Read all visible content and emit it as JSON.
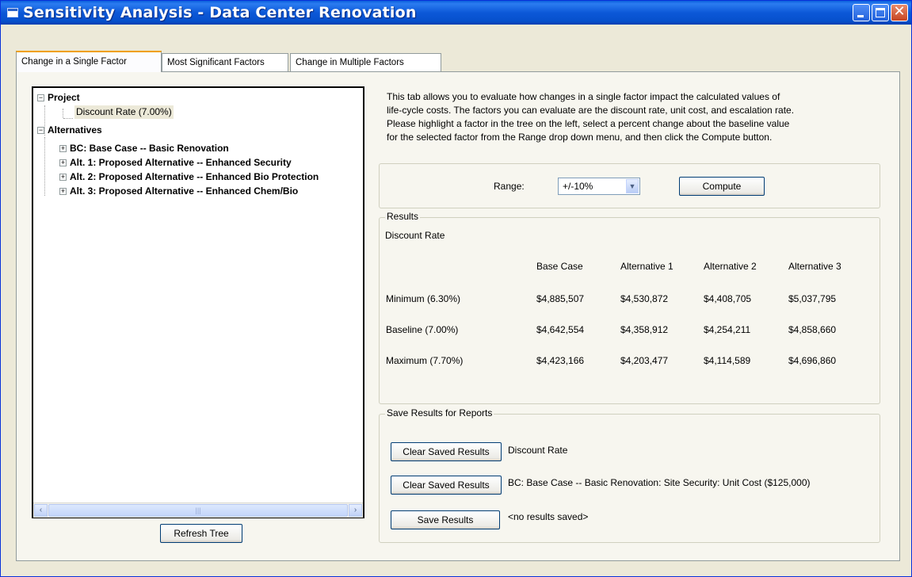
{
  "window": {
    "title": "Sensitivity Analysis - Data Center Renovation",
    "close_glyph": "✕"
  },
  "tabs": [
    {
      "label": "Change in a Single Factor",
      "active": true
    },
    {
      "label": "Most Significant Factors",
      "active": false
    },
    {
      "label": "Change in Multiple Factors",
      "active": false
    }
  ],
  "tree": {
    "collapse_glyph": "−",
    "expand_glyph": "+",
    "project": {
      "label": "Project",
      "children": [
        "Discount Rate (7.00%)"
      ]
    },
    "alternatives": {
      "label": "Alternatives",
      "children": [
        "BC: Base Case -- Basic Renovation",
        "Alt. 1: Proposed Alternative -- Enhanced Security",
        "Alt. 2: Proposed Alternative -- Enhanced Bio Protection",
        "Alt. 3: Proposed Alternative -- Enhanced Chem/Bio"
      ]
    },
    "scroll_left": "‹",
    "scroll_right": "›",
    "scroll_grip": "|||"
  },
  "refresh_label": "Refresh Tree",
  "description": [
    "This tab allows you to evaluate how changes in a single factor impact the calculated values of",
    "life-cycle costs. The factors you can evaluate are the discount rate, unit cost, and escalation rate.",
    "Please highlight a factor in the tree on the left, select a percent change about the baseline value",
    "for the selected factor from the Range drop down menu, and then click the Compute button."
  ],
  "range": {
    "label": "Range:",
    "value": "+/-10%",
    "arrow": "▼"
  },
  "compute_label": "Compute",
  "results": {
    "legend": "Results",
    "factor": "Discount Rate",
    "columns": [
      "Base Case",
      "Alternative 1",
      "Alternative 2",
      "Alternative 3"
    ],
    "rows": [
      {
        "label": "Minimum  (6.30%)",
        "values": [
          "$4,885,507",
          "$4,530,872",
          "$4,408,705",
          "$5,037,795"
        ]
      },
      {
        "label": "Baseline  (7.00%)",
        "values": [
          "$4,642,554",
          "$4,358,912",
          "$4,254,211",
          "$4,858,660"
        ]
      },
      {
        "label": "Maximum  (7.70%)",
        "values": [
          "$4,423,166",
          "$4,203,477",
          "$4,114,589",
          "$4,696,860"
        ]
      }
    ]
  },
  "save": {
    "legend": "Save Results for Reports",
    "clear_label": "Clear Saved Results",
    "save_label": "Save Results",
    "saved": [
      "Discount Rate",
      "BC: Base Case -- Basic Renovation: Site Security:  Unit Cost ($125,000)",
      "<no results saved>"
    ]
  }
}
